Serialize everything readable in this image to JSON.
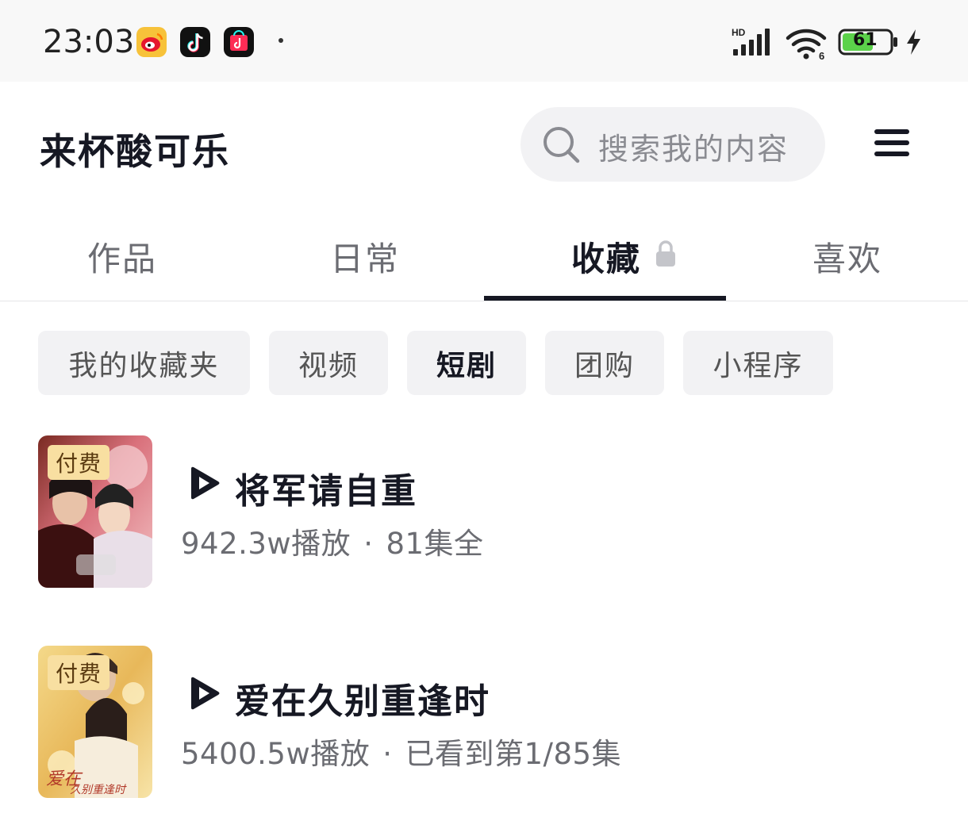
{
  "status_bar": {
    "time": "23:03",
    "apps": [
      "weibo-icon",
      "douyin-icon",
      "douyin-mall-icon"
    ],
    "network_label": "HD",
    "battery_level": "61",
    "charging": true
  },
  "header": {
    "profile_name": "来杯酸可乐",
    "search_placeholder": "搜索我的内容"
  },
  "tabs": [
    {
      "label": "作品",
      "active": false
    },
    {
      "label": "日常",
      "active": false
    },
    {
      "label": "收藏",
      "active": true,
      "locked": true
    },
    {
      "label": "喜欢",
      "active": false
    }
  ],
  "chips": [
    {
      "label": "我的收藏夹",
      "active": false
    },
    {
      "label": "视频",
      "active": false
    },
    {
      "label": "短剧",
      "active": true
    },
    {
      "label": "团购",
      "active": false
    },
    {
      "label": "小程序",
      "active": false
    }
  ],
  "dramas": [
    {
      "badge": "付费",
      "title": "将军请自重",
      "plays": "942.3w播放",
      "episodes": "81集全"
    },
    {
      "badge": "付费",
      "title": "爱在久别重逢时",
      "plays": "5400.5w播放",
      "episodes": "已看到第1/85集"
    }
  ],
  "colors": {
    "text_primary": "#161823",
    "text_secondary": "#6b6c72",
    "chip_bg": "#f2f2f4",
    "badge_bg": "#f8dfa1",
    "battery_fill": "#5bd24a"
  }
}
